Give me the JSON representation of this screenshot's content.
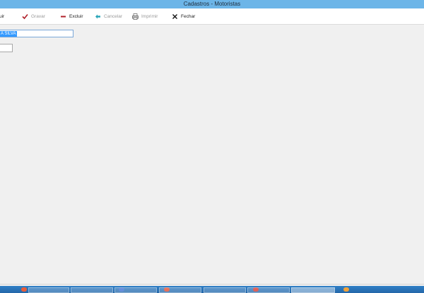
{
  "window": {
    "title": "Cadastros - Motoristas"
  },
  "toolbar": {
    "incluir_label": "uir",
    "gravar_label": "Gravar",
    "excluir_label": "Excluir",
    "cancelar_label": "Cancelar",
    "imprimir_label": "Imprimir",
    "fechar_label": "Fechar"
  },
  "form": {
    "name_value": "A SILVA",
    "second_value": ""
  },
  "colors": {
    "titlebar": "#6cb5e8",
    "selection": "#3399ff",
    "taskbar": "#2f7fc6"
  }
}
